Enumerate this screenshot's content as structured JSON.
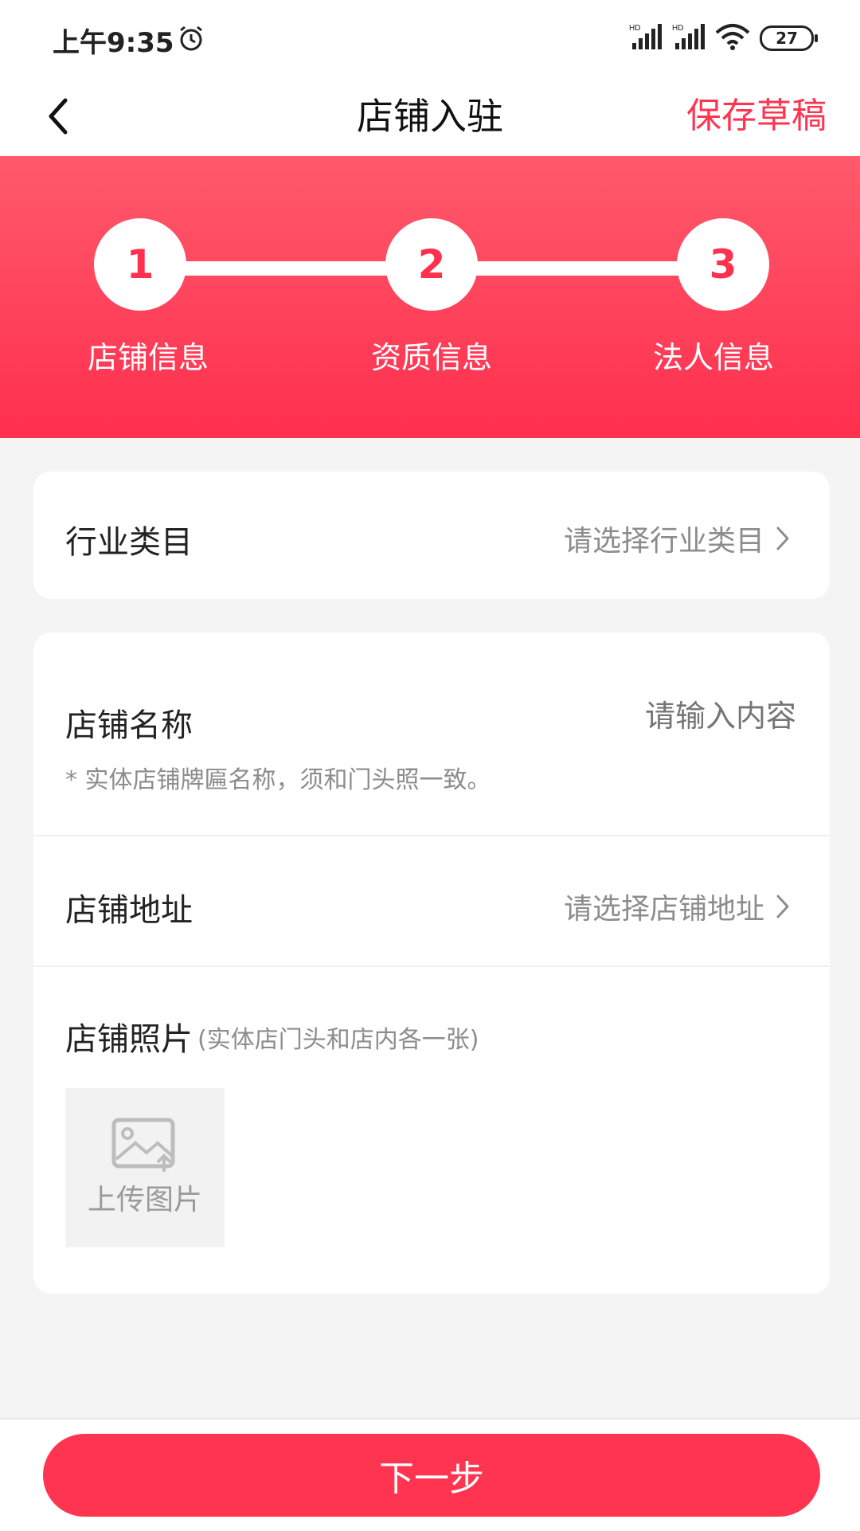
{
  "status_bar": {
    "time": "上午9:35",
    "battery": "27"
  },
  "nav": {
    "title": "店铺入驻",
    "save_draft": "保存草稿"
  },
  "steps": [
    {
      "number": "1",
      "label": "店铺信息"
    },
    {
      "number": "2",
      "label": "资质信息"
    },
    {
      "number": "3",
      "label": "法人信息"
    }
  ],
  "industry": {
    "label": "行业类目",
    "value": "请选择行业类目"
  },
  "shop_name": {
    "label": "店铺名称",
    "placeholder": "请输入内容",
    "hint": "* 实体店铺牌匾名称，须和门头照一致。"
  },
  "shop_address": {
    "label": "店铺地址",
    "value": "请选择店铺地址"
  },
  "shop_photo": {
    "label": "店铺照片",
    "sub_label": "(实体店门头和店内各一张)",
    "upload_label": "上传图片"
  },
  "footer": {
    "next_label": "下一步"
  },
  "colors": {
    "accent": "#ff3450",
    "banner_top": "#ff5a6b",
    "banner_bottom": "#ff2f4e"
  }
}
